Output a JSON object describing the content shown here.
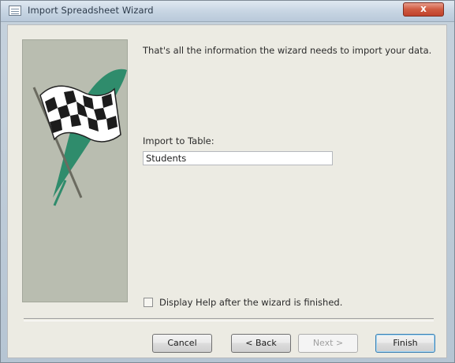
{
  "window": {
    "title": "Import Spreadsheet Wizard",
    "close_glyph": "x"
  },
  "wizard": {
    "message": "That's all the information the wizard needs to import your data.",
    "table_label": "Import to Table:",
    "table_value": "Students",
    "help_checkbox_label": "Display Help after the wizard is finished.",
    "help_checked": false
  },
  "buttons": {
    "cancel": "Cancel",
    "back": "< Back",
    "next": "Next >",
    "finish": "Finish"
  },
  "icons": {
    "window_icon": "table-icon",
    "art": "checkered-flag-icon"
  },
  "colors": {
    "art_background": "#b9bdb0",
    "swoosh": "#2f8c6c",
    "close_button": "#c94d35"
  }
}
